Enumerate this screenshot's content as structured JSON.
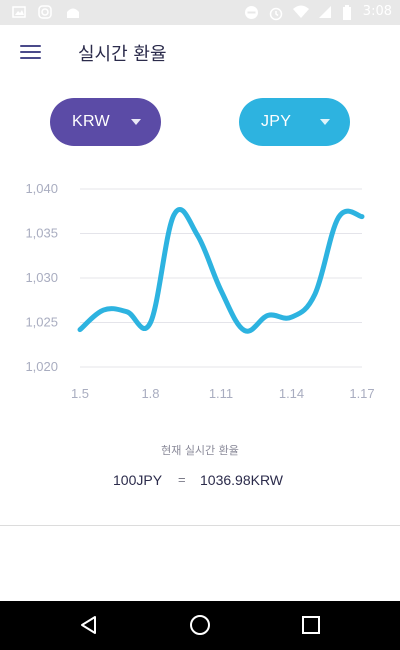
{
  "status_bar": {
    "time": "3:08",
    "left_icons": [
      "image-icon",
      "instagram-icon",
      "android-icon"
    ],
    "right_icons": [
      "dnd-icon",
      "alarm-icon",
      "wifi-icon",
      "signal-icon",
      "battery-icon"
    ]
  },
  "app_bar": {
    "title": "실시간 환율",
    "menu_icon": "hamburger-menu-icon"
  },
  "currency_selectors": {
    "from": {
      "label": "KRW",
      "color": "#5b4ba6"
    },
    "to": {
      "label": "JPY",
      "color": "#2db3e0"
    }
  },
  "chart_data": {
    "type": "line",
    "x": [
      "1.5",
      "1.6",
      "1.7",
      "1.8",
      "1.9",
      "1.10",
      "1.11",
      "1.12",
      "1.13",
      "1.14",
      "1.15",
      "1.16",
      "1.17"
    ],
    "x_tick_labels": [
      "1.5",
      "1.8",
      "1.11",
      "1.14",
      "1.17"
    ],
    "series": [
      {
        "values": [
          1024.2,
          1026.4,
          1026.2,
          1025.0,
          1037.1,
          1034.8,
          1028.6,
          1024.1,
          1025.8,
          1025.6,
          1028.2,
          1036.8,
          1036.9
        ],
        "color": "#2db3e0"
      }
    ],
    "y_tick_labels": [
      "1,040",
      "1,035",
      "1,030",
      "1,025",
      "1,020"
    ],
    "ylim": [
      1020,
      1040
    ],
    "grid": true,
    "title": "",
    "xlabel": "",
    "ylabel": ""
  },
  "summary": {
    "caption": "현재 실시간 환율",
    "left_value": "100JPY",
    "equals": "=",
    "right_value": "1036.98KRW"
  },
  "nav_bar": {
    "buttons": [
      "back-icon",
      "home-icon",
      "recents-icon"
    ]
  }
}
